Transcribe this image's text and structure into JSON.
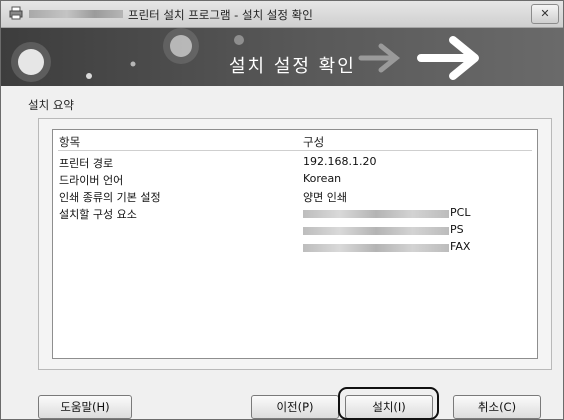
{
  "window": {
    "title": "프린터 설치 프로그램 - 설치 설정 확인",
    "close_label": "✕"
  },
  "banner": {
    "title": "설치 설정 확인"
  },
  "summary": {
    "section_label": "설치 요약",
    "columns": [
      "항목",
      "구성"
    ],
    "rows": [
      {
        "item": "프린터 경로",
        "values": [
          "192.168.1.20"
        ]
      },
      {
        "item": "드라이버 언어",
        "values": [
          "Korean"
        ]
      },
      {
        "item": "인쇄 종류의 기본 설정",
        "values": [
          "양면 인쇄"
        ]
      },
      {
        "item": "설치할 구성 요소",
        "values": [
          "PCL",
          "PS",
          "FAX"
        ]
      }
    ]
  },
  "buttons": {
    "help": "도움말(H)",
    "back": "이전(P)",
    "install": "설치(I)",
    "cancel": "취소(C)"
  }
}
